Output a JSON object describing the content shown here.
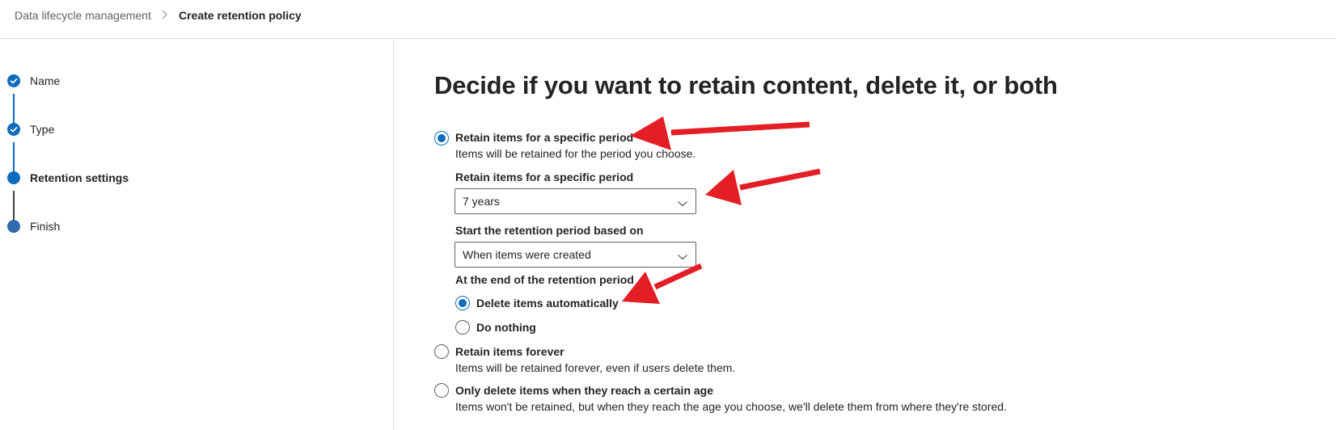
{
  "breadcrumb": {
    "root": "Data lifecycle management",
    "separator_icon": "chevron-right-icon",
    "current": "Create retention policy"
  },
  "wizard": {
    "steps": [
      {
        "label": "Name",
        "status": "completed",
        "icon": "checkmark-icon"
      },
      {
        "label": "Type",
        "status": "completed",
        "icon": "checkmark-icon"
      },
      {
        "label": "Retention settings",
        "status": "current"
      },
      {
        "label": "Finish",
        "status": "pending"
      }
    ]
  },
  "main": {
    "title": "Decide if you want to retain content, delete it, or both",
    "options": [
      {
        "label": "Retain items for a specific period",
        "description": "Items will be retained for the period you choose.",
        "selected": true
      },
      {
        "label": "Retain items forever",
        "description": "Items will be retained forever, even if users delete them.",
        "selected": false
      },
      {
        "label": "Only delete items when they reach a certain age",
        "description": "Items won't be retained, but when they reach the age you choose, we'll delete them from where they're stored.",
        "selected": false
      }
    ],
    "period_field": {
      "label": "Retain items for a specific period",
      "value": "7 years"
    },
    "start_field": {
      "label": "Start the retention period based on",
      "value": "When items were created"
    },
    "end_action": {
      "label": "At the end of the retention period",
      "options": [
        {
          "label": "Delete items automatically",
          "selected": true
        },
        {
          "label": "Do nothing",
          "selected": false
        }
      ]
    }
  },
  "colors": {
    "accent": "#0f6cbd",
    "annotation_arrow": "#e31e24"
  }
}
